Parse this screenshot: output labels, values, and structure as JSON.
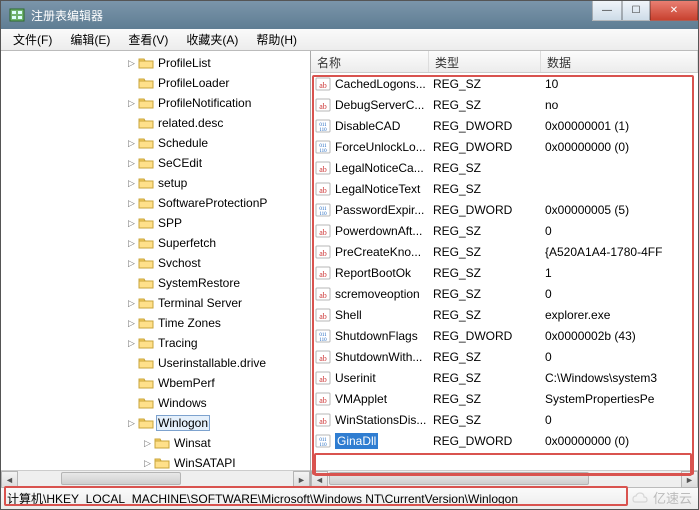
{
  "title": "注册表编辑器",
  "menus": {
    "file": "文件(F)",
    "edit": "编辑(E)",
    "view": "查看(V)",
    "favorites": "收藏夹(A)",
    "help": "帮助(H)"
  },
  "tree": {
    "items": [
      {
        "label": "ProfileList",
        "expandable": true
      },
      {
        "label": "ProfileLoader",
        "expandable": false
      },
      {
        "label": "ProfileNotification",
        "expandable": true
      },
      {
        "label": "related.desc",
        "expandable": false
      },
      {
        "label": "Schedule",
        "expandable": true
      },
      {
        "label": "SeCEdit",
        "expandable": true
      },
      {
        "label": "setup",
        "expandable": true
      },
      {
        "label": "SoftwareProtectionP",
        "expandable": true
      },
      {
        "label": "SPP",
        "expandable": true
      },
      {
        "label": "Superfetch",
        "expandable": true
      },
      {
        "label": "Svchost",
        "expandable": true
      },
      {
        "label": "SystemRestore",
        "expandable": false
      },
      {
        "label": "Terminal Server",
        "expandable": true
      },
      {
        "label": "Time Zones",
        "expandable": true
      },
      {
        "label": "Tracing",
        "expandable": true
      },
      {
        "label": "Userinstallable.drive",
        "expandable": false
      },
      {
        "label": "WbemPerf",
        "expandable": false
      },
      {
        "label": "Windows",
        "expandable": false
      },
      {
        "label": "Winlogon",
        "expandable": true
      },
      {
        "label": "Winsat",
        "expandable": true
      },
      {
        "label": "WinSATAPI",
        "expandable": true
      }
    ],
    "selected_index": 18
  },
  "columns": {
    "name": "名称",
    "type": "类型",
    "data": "数据"
  },
  "values": [
    {
      "name": "CachedLogons...",
      "type": "REG_SZ",
      "data": "10",
      "kind": "str"
    },
    {
      "name": "DebugServerC...",
      "type": "REG_SZ",
      "data": "no",
      "kind": "str"
    },
    {
      "name": "DisableCAD",
      "type": "REG_DWORD",
      "data": "0x00000001 (1)",
      "kind": "bin"
    },
    {
      "name": "ForceUnlockLo...",
      "type": "REG_DWORD",
      "data": "0x00000000 (0)",
      "kind": "bin"
    },
    {
      "name": "LegalNoticeCa...",
      "type": "REG_SZ",
      "data": "",
      "kind": "str"
    },
    {
      "name": "LegalNoticeText",
      "type": "REG_SZ",
      "data": "",
      "kind": "str"
    },
    {
      "name": "PasswordExpir...",
      "type": "REG_DWORD",
      "data": "0x00000005 (5)",
      "kind": "bin"
    },
    {
      "name": "PowerdownAft...",
      "type": "REG_SZ",
      "data": "0",
      "kind": "str"
    },
    {
      "name": "PreCreateKno...",
      "type": "REG_SZ",
      "data": "{A520A1A4-1780-4FF",
      "kind": "str"
    },
    {
      "name": "ReportBootOk",
      "type": "REG_SZ",
      "data": "1",
      "kind": "str"
    },
    {
      "name": "scremoveoption",
      "type": "REG_SZ",
      "data": "0",
      "kind": "str"
    },
    {
      "name": "Shell",
      "type": "REG_SZ",
      "data": "explorer.exe",
      "kind": "str"
    },
    {
      "name": "ShutdownFlags",
      "type": "REG_DWORD",
      "data": "0x0000002b (43)",
      "kind": "bin"
    },
    {
      "name": "ShutdownWith...",
      "type": "REG_SZ",
      "data": "0",
      "kind": "str"
    },
    {
      "name": "Userinit",
      "type": "REG_SZ",
      "data": "C:\\Windows\\system3",
      "kind": "str"
    },
    {
      "name": "VMApplet",
      "type": "REG_SZ",
      "data": "SystemPropertiesPe",
      "kind": "str"
    },
    {
      "name": "WinStationsDis...",
      "type": "REG_SZ",
      "data": "0",
      "kind": "str"
    },
    {
      "name": "GinaDll",
      "type": "REG_DWORD",
      "data": "0x00000000 (0)",
      "kind": "bin"
    }
  ],
  "selected_value_index": 17,
  "status_path": "计算机\\HKEY_LOCAL_MACHINE\\SOFTWARE\\Microsoft\\Windows NT\\CurrentVersion\\Winlogon",
  "watermark": "亿速云"
}
